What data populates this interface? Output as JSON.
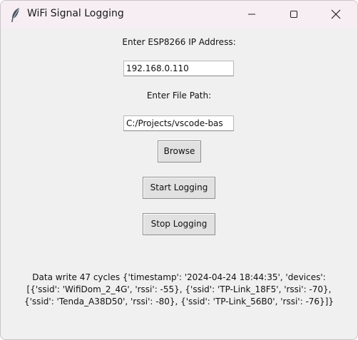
{
  "window": {
    "title": "WiFi Signal Logging",
    "icon": "feather-icon"
  },
  "controls": {
    "minimize": "minimize-icon",
    "maximize": "maximize-icon",
    "close": "close-icon"
  },
  "form": {
    "ip_label": "Enter ESP8266 IP Address:",
    "ip_value": "192.168.0.110",
    "path_label": "Enter File Path:",
    "path_value": "C:/Projects/vscode-bas",
    "browse_label": "Browse",
    "start_label": "Start Logging",
    "stop_label": "Stop Logging"
  },
  "status": {
    "line1": "Data write 47 cycles {'timestamp': '2024-04-24 18:44:35', 'devices':",
    "line2": "[{'ssid': 'WifiDom_2_4G', 'rssi': -55}, {'ssid': 'TP-Link_18F5', 'rssi': -70},",
    "line3": "{'ssid': 'Tenda_A38D50', 'rssi': -80}, {'ssid': 'TP-Link_56B0', 'rssi': -76}]}"
  }
}
